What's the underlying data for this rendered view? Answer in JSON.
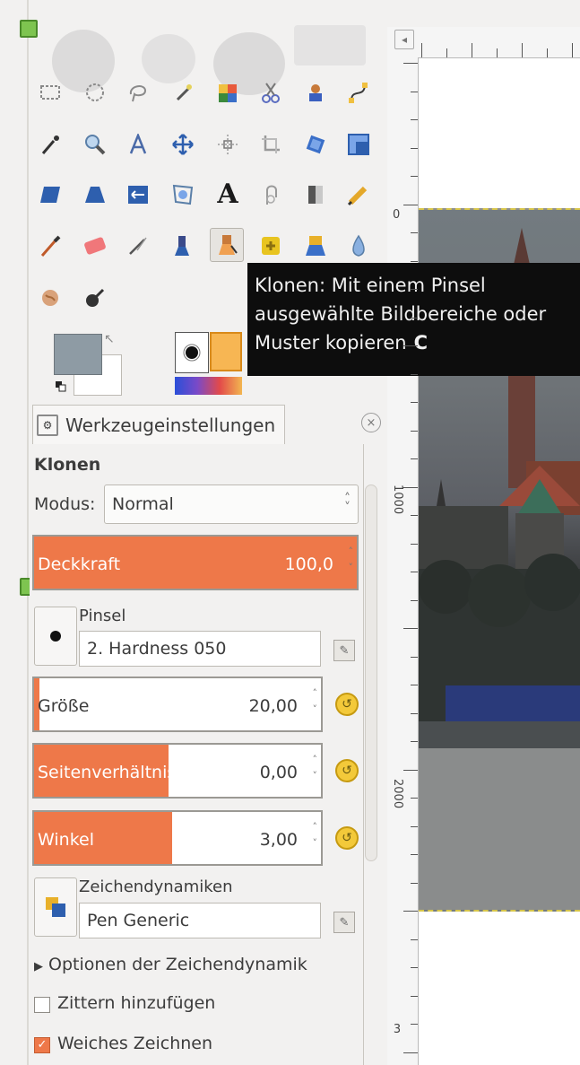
{
  "tooltip": {
    "line1": "Klonen: Mit einem Pinsel",
    "line2": "ausgewählte Bildbereiche oder",
    "line3": "Muster kopieren",
    "shortcut": "C"
  },
  "tool_options": {
    "tab_label": "Werkzeugeinstellungen",
    "tool_name": "Klonen",
    "mode_label": "Modus:",
    "mode_value": "Normal",
    "opacity": {
      "label": "Deckkraft",
      "value": "100,0",
      "fraction": 1.0
    },
    "brush": {
      "label": "Pinsel",
      "value": "2. Hardness 050"
    },
    "size": {
      "label": "Größe",
      "value": "20,00",
      "fraction": 0.02
    },
    "aspect": {
      "label": "Seitenverhältnis",
      "value": "0,00",
      "fraction": 0.47
    },
    "angle": {
      "label": "Winkel",
      "value": "3,00",
      "fraction": 0.48
    },
    "dynamics": {
      "label": "Zeichendynamiken",
      "value": "Pen Generic"
    },
    "dynamics_options": "Optionen der Zeichendynamik",
    "jitter": {
      "label": "Zittern hinzufügen",
      "checked": false
    },
    "smooth": {
      "label": "Weiches Zeichnen",
      "checked": true
    }
  },
  "ruler": {
    "top_marker": "0",
    "left_labels": [
      "0",
      "1000",
      "2000",
      "3"
    ]
  },
  "colors": {
    "foreground": "#8e9ba4",
    "background": "#ffffff",
    "accent": "#ee7849",
    "tooltip_bg": "#0d0d0d"
  },
  "icons": [
    "rect-select-icon",
    "ellipse-select-icon",
    "lasso-icon",
    "fuzzy-select-icon",
    "color-select-icon",
    "scissors-icon",
    "foreground-select-icon",
    "paths-icon",
    "color-picker-icon",
    "zoom-icon",
    "measure-icon",
    "move-icon",
    "align-icon",
    "crop-icon",
    "rotate-icon",
    "scale-icon",
    "shear-icon",
    "perspective-icon",
    "flip-icon",
    "cage-icon",
    "text-icon",
    "warp-icon",
    "bucket-fill-icon",
    "pencil-icon",
    "paintbrush-icon",
    "eraser-icon",
    "airbrush-icon",
    "ink-icon",
    "clone-icon",
    "heal-icon",
    "perspective-clone-icon",
    "blur-icon",
    "smudge-icon",
    "dodge-burn-icon"
  ]
}
